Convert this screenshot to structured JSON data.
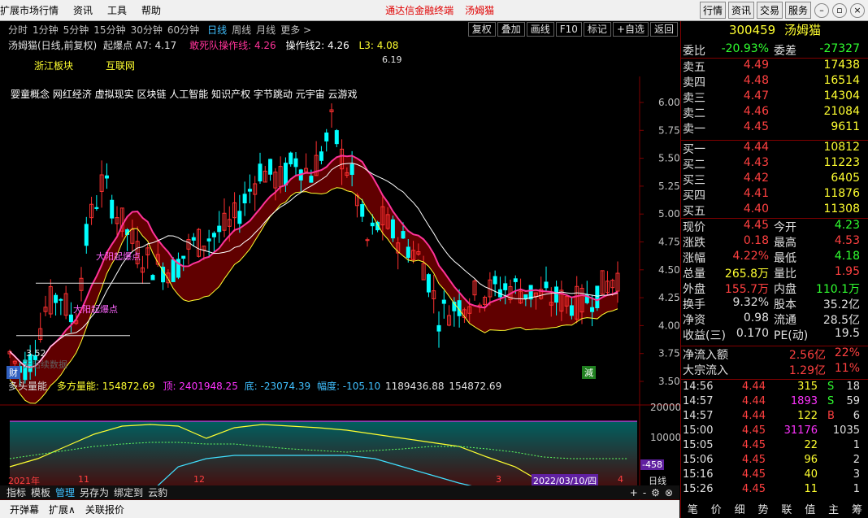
{
  "menubar": {
    "items": [
      "扩展市场行情",
      "资讯",
      "工具",
      "帮助"
    ],
    "promo": [
      "通达信金融终端",
      "汤姆猫"
    ],
    "right_buttons": [
      "行情",
      "资讯",
      "交易",
      "服务"
    ]
  },
  "periods": [
    "分时",
    "1分钟",
    "5分钟",
    "15分钟",
    "30分钟",
    "60分钟",
    "日线",
    "周线",
    "月线",
    "更多 >"
  ],
  "active_period": "日线",
  "toolbar": [
    "复权",
    "叠加",
    "画线",
    "F10",
    "标记",
    "+自选",
    "返回"
  ],
  "title": {
    "name": "汤姆猫(日线,前复权)",
    "ind": "起爆点 A7: 4.17",
    "l1": "敢死队操作线: 4.26",
    "l2": "操作线2: 4.26",
    "l3": "L3: 4.08"
  },
  "boards": [
    "浙江板块",
    "互联网"
  ],
  "concepts": "婴童概念 网红经济 虚拟现实 区块链 人工智能 知识产权 字节跳动 元宇宙 云游戏",
  "annotations": {
    "high": "6.19",
    "low": "3.52",
    "marker1": "大阳起爆点",
    "marker2": "大阳起爆点",
    "no_data": "无后续数据",
    "cai": "财",
    "jian": "減"
  },
  "yaxis": [
    "6.00",
    "5.75",
    "5.50",
    "5.25",
    "5.00",
    "4.75",
    "4.50",
    "4.25",
    "4.00",
    "3.75",
    "3.50"
  ],
  "sub": {
    "name": "多头量能",
    "v1": "多方量能: 154872.69",
    "v2": "顶: 2401948.25",
    "v3": "底: -23074.39",
    "v4": "幅度: -105.10",
    "v5": "1189436.88",
    "v6": "154872.69",
    "yaxis": [
      "20000",
      "10000"
    ],
    "current": "-458"
  },
  "xaxis": {
    "year": "2021年",
    "m11": "11",
    "m12": "12",
    "m3": "3",
    "m4": "4",
    "date": "2022/03/10/四",
    "label": "日线"
  },
  "bottom1": [
    "指标",
    "模板",
    "管理",
    "另存为",
    "绑定到",
    "云豹"
  ],
  "bottom1_active": "管理",
  "bottom2": [
    "开弹幕",
    "扩展∧",
    "关联报价"
  ],
  "quote": {
    "code": "300459",
    "name": "汤姆猫",
    "weibi_label": "委比",
    "weibi": "-20.93%",
    "weicha_label": "委差",
    "weicha": "-27327",
    "asks": [
      [
        "卖五",
        "4.49",
        "17438"
      ],
      [
        "卖四",
        "4.48",
        "16514"
      ],
      [
        "卖三",
        "4.47",
        "14304"
      ],
      [
        "卖二",
        "4.46",
        "21084"
      ],
      [
        "卖一",
        "4.45",
        "9611"
      ]
    ],
    "bids": [
      [
        "买一",
        "4.44",
        "10812"
      ],
      [
        "买二",
        "4.43",
        "11223"
      ],
      [
        "买三",
        "4.42",
        "6405"
      ],
      [
        "买四",
        "4.41",
        "11876"
      ],
      [
        "买五",
        "4.40",
        "11308"
      ]
    ],
    "stats": [
      [
        "现价",
        "4.45",
        "今开",
        "4.23"
      ],
      [
        "涨跌",
        "0.18",
        "最高",
        "4.53"
      ],
      [
        "涨幅",
        "4.22%",
        "最低",
        "4.18"
      ],
      [
        "总量",
        "265.8万",
        "量比",
        "1.95"
      ],
      [
        "外盘",
        "155.7万",
        "内盘",
        "110.1万"
      ],
      [
        "换手",
        "9.32%",
        "股本",
        "35.2亿"
      ],
      [
        "净资",
        "0.98",
        "流通",
        "28.5亿"
      ],
      [
        "收益(三)",
        "0.170",
        "PE(动)",
        "19.5"
      ]
    ],
    "flows": [
      [
        "净流入额",
        "2.56亿",
        "22%"
      ],
      [
        "大宗流入",
        "1.29亿",
        "11%"
      ]
    ],
    "ticks": [
      [
        "14:56",
        "4.44",
        "315",
        "S",
        "18"
      ],
      [
        "14:57",
        "4.44",
        "1893",
        "S",
        "59"
      ],
      [
        "14:57",
        "4.44",
        "122",
        "B",
        "6"
      ],
      [
        "15:00",
        "4.45",
        "31176",
        "",
        "1035"
      ],
      [
        "15:05",
        "4.45",
        "22",
        "",
        "1"
      ],
      [
        "15:06",
        "4.45",
        "96",
        "",
        "2"
      ],
      [
        "15:16",
        "4.45",
        "40",
        "",
        "3"
      ],
      [
        "15:26",
        "4.45",
        "11",
        "",
        "1"
      ]
    ],
    "tabs": [
      "笔",
      "价",
      "细",
      "势",
      "联",
      "值",
      "主",
      "筹"
    ]
  },
  "colors": {
    "up": "#ff3030",
    "down": "#00ffff",
    "red_cloud": "#6a0000",
    "pink": "#ff3399",
    "yellow": "#ffff30"
  }
}
